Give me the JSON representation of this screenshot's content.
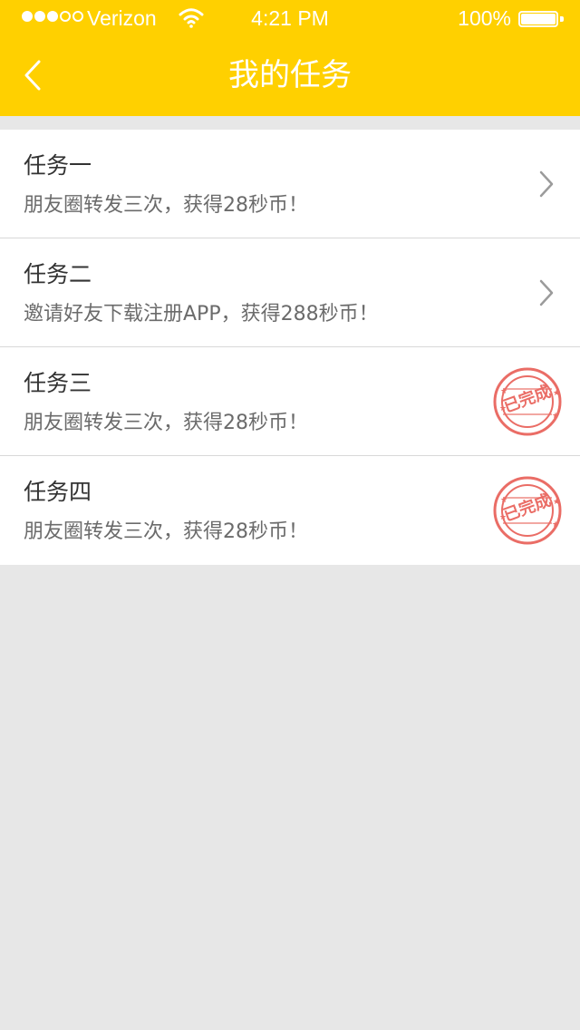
{
  "status_bar": {
    "carrier": "Verizon",
    "time": "4:21 PM",
    "battery_percent": "100%",
    "signal_icon": "signal-dots-icon",
    "wifi_icon": "wifi-icon",
    "battery_icon": "battery-icon"
  },
  "navigation": {
    "title": "我的任务",
    "back_icon": "back-chevron-icon"
  },
  "colors": {
    "brand_yellow": "#ffd000",
    "background_gray": "#e7e7e7",
    "stamp_red": "#ea6d66"
  },
  "tasks": [
    {
      "title": "任务一",
      "description": "朋友圈转发三次，获得28秒币！",
      "status": "open",
      "trailing_icon": "chevron-right-icon"
    },
    {
      "title": "任务二",
      "description": "邀请好友下载注册APP，获得288秒币！",
      "status": "open",
      "trailing_icon": "chevron-right-icon"
    },
    {
      "title": "任务三",
      "description": "朋友圈转发三次，获得28秒币！",
      "status": "completed",
      "stamp_label": "已完成",
      "trailing_icon": "completed-stamp-icon"
    },
    {
      "title": "任务四",
      "description": "朋友圈转发三次，获得28秒币！",
      "status": "completed",
      "stamp_label": "已完成",
      "trailing_icon": "completed-stamp-icon"
    }
  ]
}
